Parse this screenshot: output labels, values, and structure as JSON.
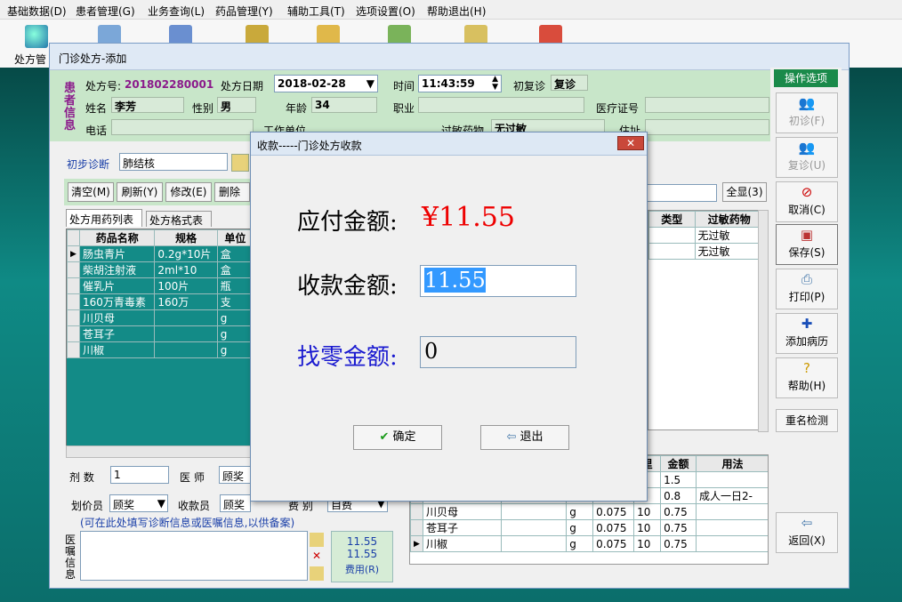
{
  "menu": [
    "基础数据(D)",
    "患者管理(G)",
    "业务查询(L)",
    "药品管理(Y)",
    "辅助工具(T)",
    "选项设置(O)",
    "帮助退出(H)"
  ],
  "toolbar": {
    "rx_label": "处方管"
  },
  "window": {
    "title": "门诊处方-添加"
  },
  "patient": {
    "side_label": "患者信息",
    "rx_no_label": "处方号:",
    "rx_no": "201802280001",
    "rx_date_label": "处方日期",
    "rx_date": "2018-02-28",
    "time_label": "时间",
    "time": "11:43:59",
    "visit_label": "初复诊",
    "visit": "复诊",
    "name_label": "姓名",
    "name": "李芳",
    "sex_label": "性别",
    "sex": "男",
    "age_label": "年龄",
    "age": "34",
    "job_label": "职业",
    "job": "",
    "insurance_label": "医疗证号",
    "insurance": "",
    "phone_label": "电话",
    "phone": "",
    "work_label": "工作单位",
    "allergy_label": "过敏药物",
    "allergy": "无过敏",
    "address_label": "住址"
  },
  "diagnosis": {
    "label": "初步诊断",
    "value": "肺结核"
  },
  "actions": {
    "clear": "清空(M)",
    "refresh": "刷新(Y)",
    "edit": "修改(E)",
    "delete": "删除行",
    "show_all": "全显(3)"
  },
  "tabs": {
    "list": "处方用药列表",
    "format": "处方格式表"
  },
  "drug_table": {
    "headers": [
      "药品名称",
      "规格",
      "单位"
    ],
    "rows": [
      [
        "肠虫青片",
        "0.2g*10片",
        "盒"
      ],
      [
        "柴胡注射液",
        "2ml*10",
        "盒"
      ],
      [
        "催乳片",
        "100片",
        "瓶"
      ],
      [
        "160万青毒素",
        "160万",
        "支"
      ],
      [
        "川贝母",
        "",
        "g"
      ],
      [
        "苍耳子",
        "",
        "g"
      ],
      [
        "川椒",
        "",
        "g"
      ]
    ]
  },
  "right_table": {
    "headers": [
      "类型",
      "过敏药物"
    ],
    "rows": [
      [
        "",
        "无过敏"
      ],
      [
        "",
        "无过敏"
      ]
    ]
  },
  "bottom_table": {
    "headers": [
      "里",
      "金额",
      "用法"
    ],
    "rows": [
      [
        "",
        "",
        "",
        "1",
        "1.5",
        ""
      ],
      [
        "",
        "",
        "",
        "1",
        "0.8",
        "成人一日2-"
      ],
      [
        "川贝母",
        "g",
        "0.075",
        "10",
        "0.75",
        ""
      ],
      [
        "苍耳子",
        "g",
        "0.075",
        "10",
        "0.75",
        ""
      ],
      [
        "川椒",
        "g",
        "0.075",
        "10",
        "0.75",
        ""
      ]
    ]
  },
  "bottom_form": {
    "dose_label": "剂  数",
    "dose": "1",
    "doctor_label": "医  师",
    "doctor": "顾奖",
    "pricer_label": "划价员",
    "pricer": "顾奖",
    "cashier_label": "收款员",
    "cashier": "顾奖",
    "fee_label": "费  别",
    "fee": "自费",
    "hint": "(可在此处填写诊断信息或医嘱信息,以供备案)",
    "advice_label": "医嘱信息",
    "total1": "11.55",
    "total2": "11.55",
    "cost_btn": "费用(R)"
  },
  "sidebar": {
    "title": "操作选项",
    "items": [
      "初诊(F)",
      "复诊(U)",
      "取消(C)",
      "保存(S)",
      "打印(P)",
      "添加病历",
      "帮助(H)",
      "重名检测",
      "返回(X)"
    ]
  },
  "dialog": {
    "title": "收款-----门诊处方收款",
    "due_label": "应付金额:",
    "due_value": "¥11.55",
    "paid_label": "收款金额:",
    "paid_value": "11.55",
    "change_label": "找零金额:",
    "change_value": "0",
    "ok": "确定",
    "exit": "退出"
  }
}
